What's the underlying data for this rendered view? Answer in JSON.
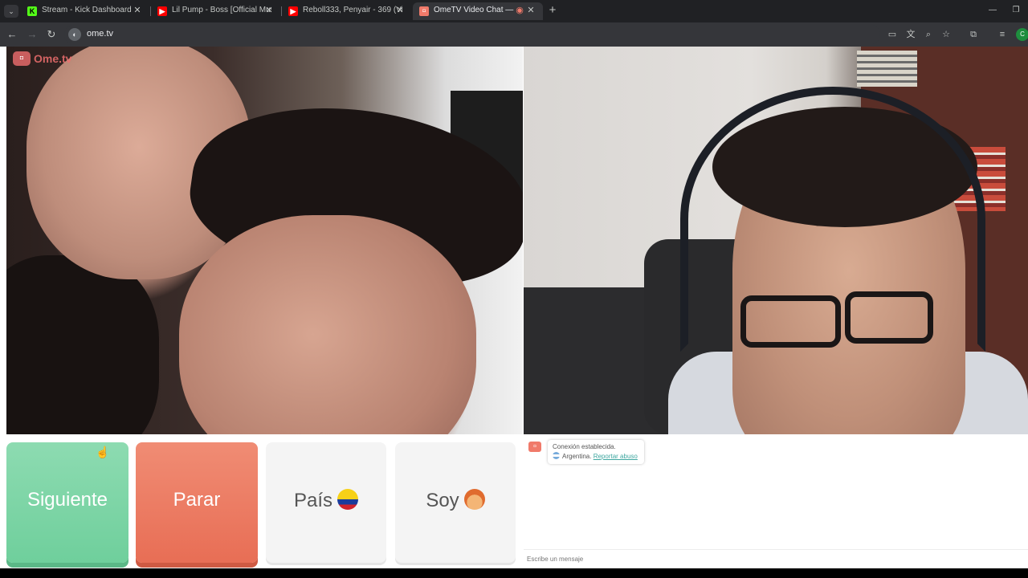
{
  "browser": {
    "tabs": [
      {
        "title": "Stream - Kick Dashboard",
        "favicon": "kick-icon",
        "active": false
      },
      {
        "title": "Lil Pump - Boss [Official Music V",
        "favicon": "youtube-icon",
        "active": false
      },
      {
        "title": "Reboll333, Penyair - 369 (Video",
        "favicon": "youtube-icon",
        "active": false
      },
      {
        "title": "OmeTV Video Chat — Ome",
        "favicon": "ometv-icon",
        "active": true
      }
    ],
    "url": "ome.tv",
    "profile_initial": "C"
  },
  "video": {
    "logo_text": "Ome.tv"
  },
  "buttons": {
    "next_label": "Siguiente",
    "stop_label": "Parar",
    "country_label": "País",
    "me_label": "Soy"
  },
  "chat": {
    "status_text": "Conexión establecida.",
    "country_text": "Argentina.",
    "report_link": "Reportar abuso",
    "input_placeholder": "Escribe un mensaje"
  },
  "colors": {
    "next_button": "#6fcf9c",
    "stop_button": "#e86e55",
    "link": "#3fa7a0"
  }
}
